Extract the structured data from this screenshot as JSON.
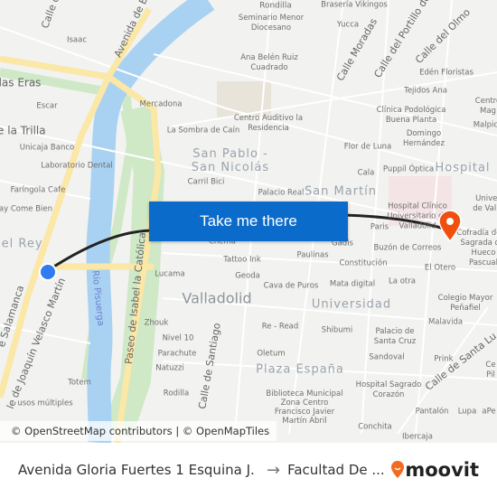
{
  "map": {
    "labels": [
      "Calle de",
      "Avenida de B",
      "Isaac",
      "Seminario Menor Diocesano",
      "Rondilla",
      "Brasería Vikingos",
      "Yucca",
      "Calle Moradas",
      "Calle del Portillo de",
      "Calle del Olmo",
      "Ana Belén Ruiz Cuadrado",
      "Edén Floristas",
      "Tejidos Ana",
      "Centro Mag",
      "Malpica",
      "las Eras",
      "Escar",
      "Mercadona",
      "de la Trilla",
      "Unicaja Banco",
      "Laboratorio Dental",
      "La Sombra de Caín",
      "Centro Auditivo la Residencia",
      "Clínica Podológica Buena Planta",
      "Domingo Hernández",
      "Flor de Luna",
      "Faríngola Cafe",
      "way Come Bien",
      "Carril Bici",
      "Cala",
      "Puppil Óptica",
      "Palacio Real",
      "Univer de Valla",
      "del Rey",
      "Chema",
      "Gadis",
      "Paris",
      "Hospital Clínico Universitario de Valladolid",
      "Buzón de Correos",
      "Cofradía de la Sagrada del Hueco Pascual",
      "Tattoo Ink",
      "Lucama",
      "Paulinas",
      "Constitución",
      "El Otero",
      "Geoda",
      "Cava de Puros",
      "Mata digital",
      "La otra",
      "Colegio Mayor Peñafiel",
      "Zhouk",
      "Nivel 10",
      "Parachute",
      "Natuzzi",
      "Re - Read",
      "Shibumi",
      "Palacio de Santa Cruz",
      "Malavida",
      "Oletum",
      "Sandoval",
      "Prink",
      "Totem",
      "Rodilla",
      "Biblioteca Municipal Zona Centro Francisco Javier Martín Abril",
      "Hospital Sagrado Corazón",
      "Pantalón",
      "Lupa",
      "aPe",
      "usos múltiples",
      "Conchita",
      "Ibercaja",
      "Calle de Santa Lu",
      "Ce Pil"
    ],
    "streets": {
      "salamanca": "e Salamanca",
      "velasco": "le de Joaquín Velasco Martín",
      "paseo": "Paseo de Isabel la Católica",
      "santiago": "Calle de Santiago"
    },
    "river": "Río Pisuerga",
    "districts": {
      "sanpablo": "San Pablo - San Nicolás",
      "sanmartin": "San Martín",
      "hospital": "Hospital",
      "universidad": "Universidad",
      "plaza": "Plaza España",
      "city": "Valladolid"
    },
    "route_color": "#222222",
    "origin_color": "#2f7bf0",
    "dest_color": "#f0500f"
  },
  "cta": "Take me there",
  "attribution": "© OpenStreetMap contributors | © OpenMapTiles",
  "bar": {
    "from": "Avenida Gloria Fuertes 1 Esquina J...",
    "arrow": "→",
    "to": "Facultad De ...",
    "brand": "moovit"
  }
}
